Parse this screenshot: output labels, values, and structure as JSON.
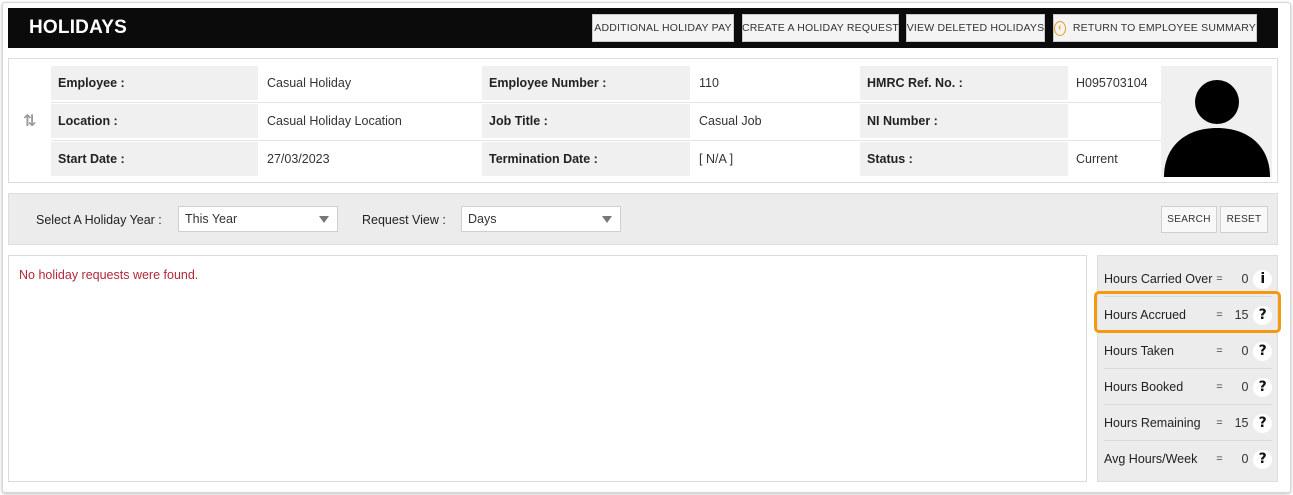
{
  "header": {
    "title": "HOLIDAYS",
    "buttons": {
      "additional_pay": "ADDITIONAL HOLIDAY PAY",
      "create_request": "CREATE A HOLIDAY REQUEST",
      "view_deleted": "VIEW DELETED HOLIDAYS",
      "return_summary": "RETURN TO EMPLOYEE SUMMARY"
    }
  },
  "employee": {
    "rows": [
      [
        {
          "label": "Employee :",
          "value": "Casual Holiday"
        },
        {
          "label": "Employee Number :",
          "value": "110"
        },
        {
          "label": "HMRC Ref. No. :",
          "value": "H095703104"
        }
      ],
      [
        {
          "label": "Location :",
          "value": "Casual Holiday Location"
        },
        {
          "label": "Job Title :",
          "value": "Casual Job"
        },
        {
          "label": "NI Number :",
          "value": ""
        }
      ],
      [
        {
          "label": "Start Date :",
          "value": "27/03/2023"
        },
        {
          "label": "Termination Date :",
          "value": "[ N/A ]"
        },
        {
          "label": "Status :",
          "value": "Current"
        }
      ]
    ]
  },
  "filters": {
    "year_label": "Select A Holiday Year :",
    "year_value": "This Year",
    "view_label": "Request View :",
    "view_value": "Days",
    "search": "SEARCH",
    "reset": "RESET"
  },
  "results": {
    "message": "No holiday requests were found."
  },
  "stats": [
    {
      "name": "Hours Carried Over",
      "value": "0",
      "icon": "info-icon",
      "glyph": "i"
    },
    {
      "name": "Hours Accrued",
      "value": "15",
      "icon": "help-icon",
      "glyph": "?"
    },
    {
      "name": "Hours Taken",
      "value": "0",
      "icon": "help-icon",
      "glyph": "?"
    },
    {
      "name": "Hours Booked",
      "value": "0",
      "icon": "help-icon",
      "glyph": "?"
    },
    {
      "name": "Hours Remaining",
      "value": "15",
      "icon": "help-icon",
      "glyph": "?"
    },
    {
      "name": "Avg Hours/Week",
      "value": "0",
      "icon": "help-icon",
      "glyph": "?"
    }
  ],
  "eq_sign": "=",
  "colors": {
    "header_bg": "#0b0b0b",
    "highlight": "#f39a12",
    "message": "#b0283c",
    "return_icon": "#e8a020"
  }
}
